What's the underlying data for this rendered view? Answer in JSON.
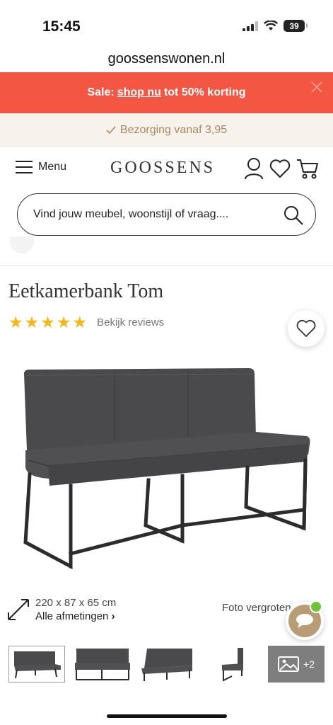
{
  "status": {
    "time": "15:45",
    "battery": "39"
  },
  "browser": {
    "url": "goossenswonen.nl"
  },
  "sale_banner": {
    "prefix": "Sale:",
    "link": "shop nu",
    "suffix": "tot 50% korting",
    "color": "#f35744"
  },
  "delivery": {
    "text": "Bezorging vanaf 3,95",
    "color": "#a68a5c"
  },
  "header": {
    "menu_label": "Menu",
    "logo": "GOOSSENS"
  },
  "search": {
    "placeholder": "Vind jouw meubel, woonstijl of vraag...."
  },
  "product": {
    "title": "Eetkamerbank Tom",
    "rating": 5,
    "reviews_link": "Bekijk reviews",
    "dimensions": "220 x 87 x 65 cm",
    "all_dimensions": "Alle afmetingen",
    "zoom_label": "Foto vergroten",
    "thumbs_more": "+2"
  },
  "icons": [
    "hamburger-icon",
    "user-icon",
    "heart-icon",
    "cart-icon",
    "search-icon",
    "resize-icon",
    "chat-icon",
    "image-icon"
  ]
}
